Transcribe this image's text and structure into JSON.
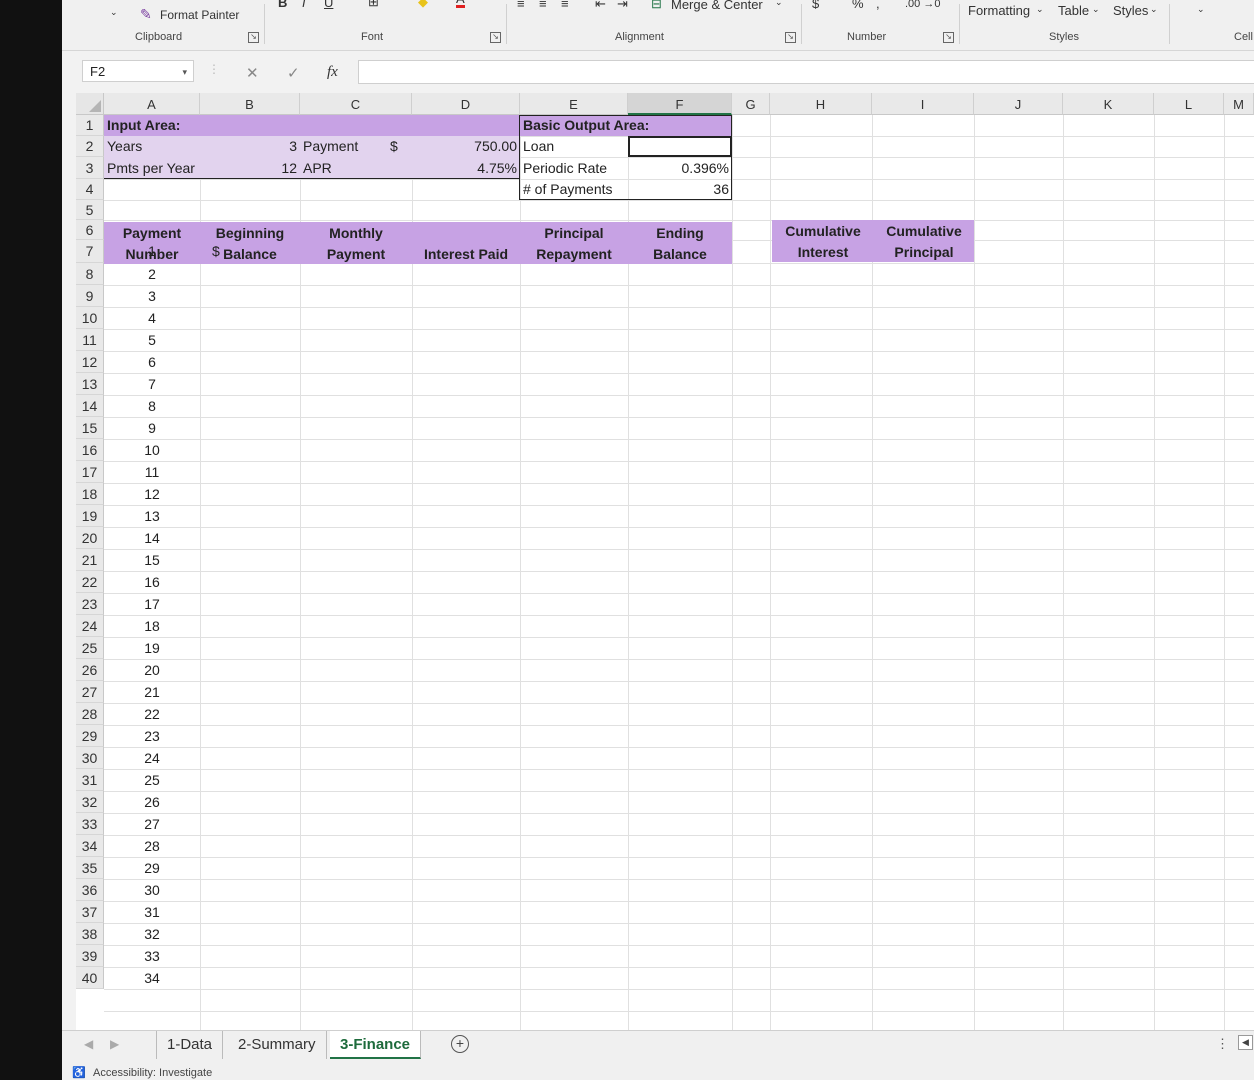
{
  "ribbon": {
    "format_painter": "Format Painter",
    "clipboard": "Clipboard",
    "font": "Font",
    "alignment": "Alignment",
    "merge_center": "Merge & Center",
    "number": "Number",
    "formatting": "Formatting",
    "table": "Table",
    "styles_btn": "Styles",
    "styles": "Styles",
    "cells": "Cell",
    "percent": "%",
    "decimals": ".00 →0"
  },
  "formula_bar": {
    "name_box": "F2",
    "cancel": "✕",
    "enter": "✓",
    "fx": "fx"
  },
  "columns": [
    "A",
    "B",
    "C",
    "D",
    "E",
    "F",
    "G",
    "H",
    "I",
    "J",
    "K",
    "L",
    "M"
  ],
  "active_column": "F",
  "rows": [
    "1",
    "2",
    "3",
    "4",
    "5",
    "6",
    "7",
    "8",
    "9",
    "10",
    "11",
    "12",
    "13",
    "14",
    "15",
    "16",
    "17",
    "18",
    "19",
    "20",
    "21",
    "22",
    "23",
    "24",
    "25",
    "26",
    "27",
    "28",
    "29",
    "30",
    "31",
    "32",
    "33",
    "34",
    "35",
    "36",
    "37",
    "38",
    "39",
    "40"
  ],
  "input_area": {
    "title": "Input Area:",
    "years_label": "Years",
    "years": "3",
    "pmts_label": "Pmts per Year",
    "pmts": "12",
    "payment_label": "Payment",
    "payment_currency": "$",
    "payment": "750.00",
    "apr_label": "APR",
    "apr": "4.75%"
  },
  "output_area": {
    "title": "Basic Output Area:",
    "loan_label": "Loan",
    "loan": "",
    "rate_label": "Periodic Rate",
    "rate": "0.396%",
    "npay_label": "# of Payments",
    "npay": "36"
  },
  "schedule_headers": {
    "a1": "Payment",
    "a2": "Number",
    "b1": "Beginning",
    "b2": "Balance",
    "c1": "Monthly",
    "c2": "Payment",
    "d2": "Interest Paid",
    "e1": "Principal",
    "e2": "Repayment",
    "f1": "Ending",
    "f2": "Balance",
    "h1": "Cumulative",
    "h2": "Interest",
    "i1": "Cumulative",
    "i2": "Principal"
  },
  "first_balance": {
    "currency": "$",
    "value": "-"
  },
  "payment_numbers": [
    "1",
    "2",
    "3",
    "4",
    "5",
    "6",
    "7",
    "8",
    "9",
    "10",
    "11",
    "12",
    "13",
    "14",
    "15",
    "16",
    "17",
    "18",
    "19",
    "20",
    "21",
    "22",
    "23",
    "24",
    "25",
    "26",
    "27",
    "28",
    "29",
    "30",
    "31",
    "32",
    "33",
    "34"
  ],
  "sheets": [
    "1-Data",
    "2-Summary",
    "3-Finance"
  ],
  "active_sheet": "3-Finance",
  "status": "Accessibility: Investigate",
  "colors": {
    "purple_fill": "#c7a2e4",
    "excel_green": "#217346"
  }
}
